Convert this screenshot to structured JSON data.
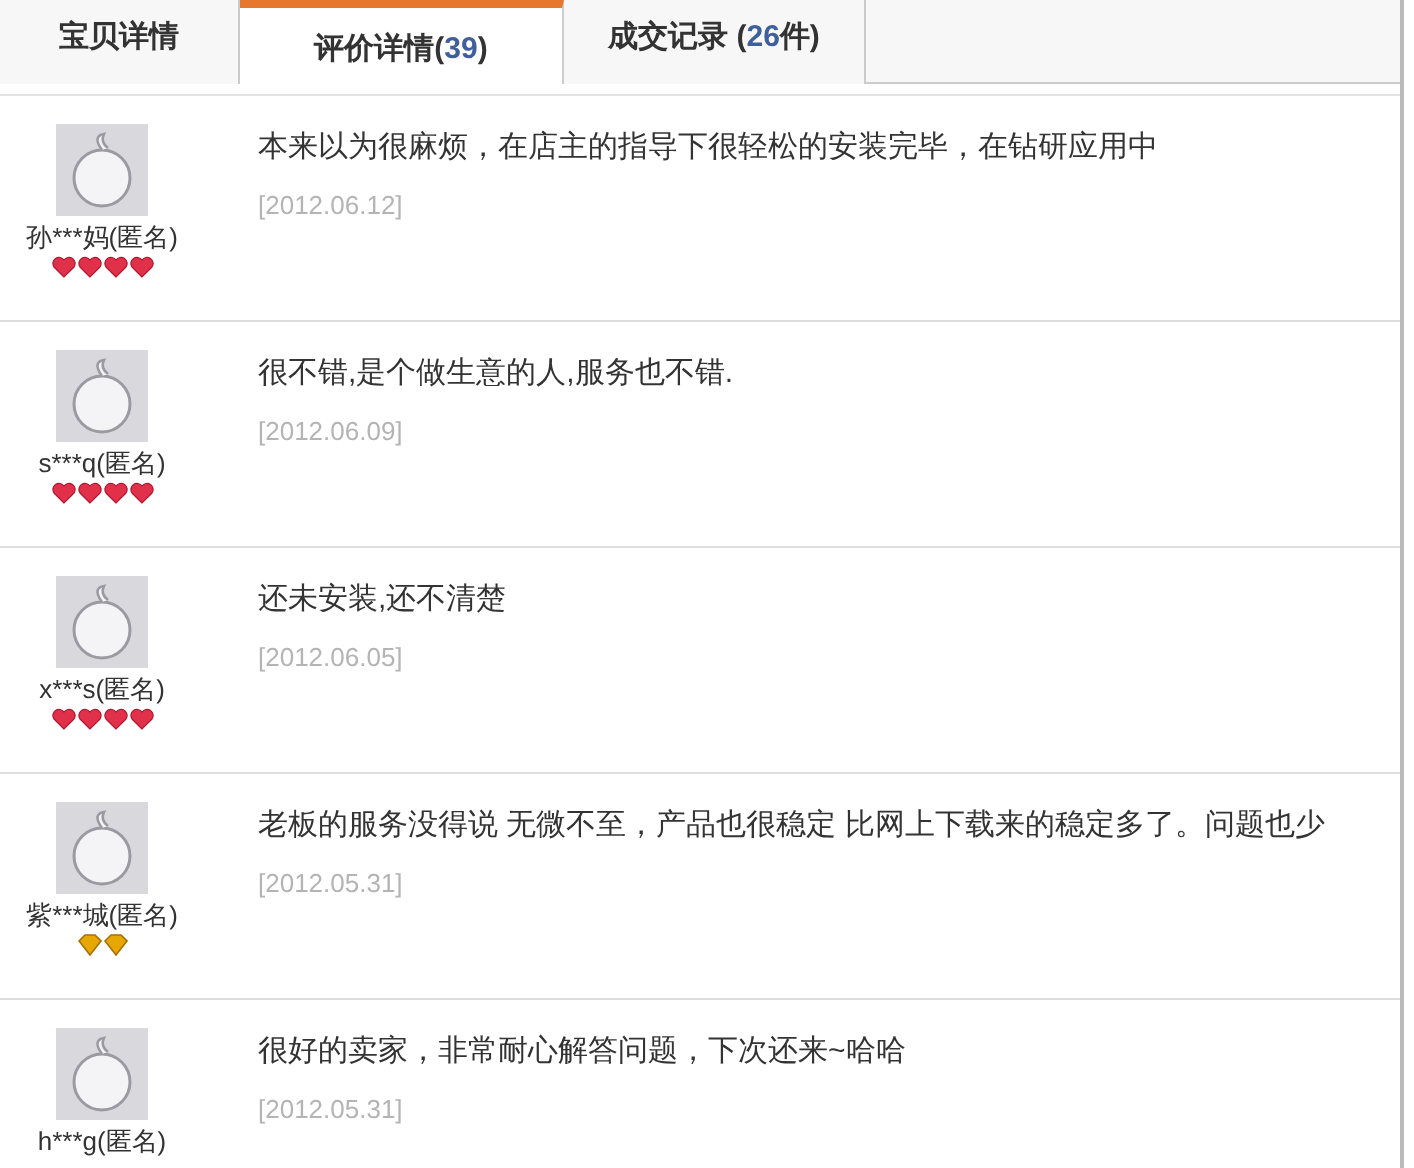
{
  "tabs": [
    {
      "parts": [
        {
          "text": "宝贝详情",
          "kind": "label"
        }
      ],
      "selected": false
    },
    {
      "parts": [
        {
          "text": "评价详情(",
          "kind": "label"
        },
        {
          "text": "39",
          "kind": "count"
        },
        {
          "text": ")",
          "kind": "label"
        }
      ],
      "selected": true
    },
    {
      "parts": [
        {
          "text": "成交记录 (",
          "kind": "label"
        },
        {
          "text": "26",
          "kind": "count"
        },
        {
          "text": "件)",
          "kind": "label"
        }
      ],
      "selected": false
    }
  ],
  "reviews": [
    {
      "user": "孙***妈(匿名)",
      "rank_icons": [
        {
          "kind": "heart"
        },
        {
          "kind": "heart"
        },
        {
          "kind": "heart"
        },
        {
          "kind": "heart"
        }
      ],
      "comment": "本来以为很麻烦，在店主的指导下很轻松的安装完毕，在钻研应用中",
      "date": "[2012.06.12]"
    },
    {
      "user": "s***q(匿名)",
      "rank_icons": [
        {
          "kind": "heart"
        },
        {
          "kind": "heart"
        },
        {
          "kind": "heart"
        },
        {
          "kind": "heart"
        }
      ],
      "comment": "很不错,是个做生意的人,服务也不错.",
      "date": "[2012.06.09]"
    },
    {
      "user": "x***s(匿名)",
      "rank_icons": [
        {
          "kind": "heart"
        },
        {
          "kind": "heart"
        },
        {
          "kind": "heart"
        },
        {
          "kind": "heart"
        }
      ],
      "comment": "还未安装,还不清楚",
      "date": "[2012.06.05]"
    },
    {
      "user": "紫***城(匿名)",
      "rank_icons": [
        {
          "kind": "diamond"
        },
        {
          "kind": "diamond"
        }
      ],
      "comment": "老板的服务没得说 无微不至，产品也很稳定 比网上下载来的稳定多了。问题也少",
      "date": "[2012.05.31]"
    },
    {
      "user": "h***g(匿名)",
      "comment": "很好的卖家，非常耐心解答问题，下次还来~哈哈",
      "date": "[2012.05.31]"
    }
  ]
}
